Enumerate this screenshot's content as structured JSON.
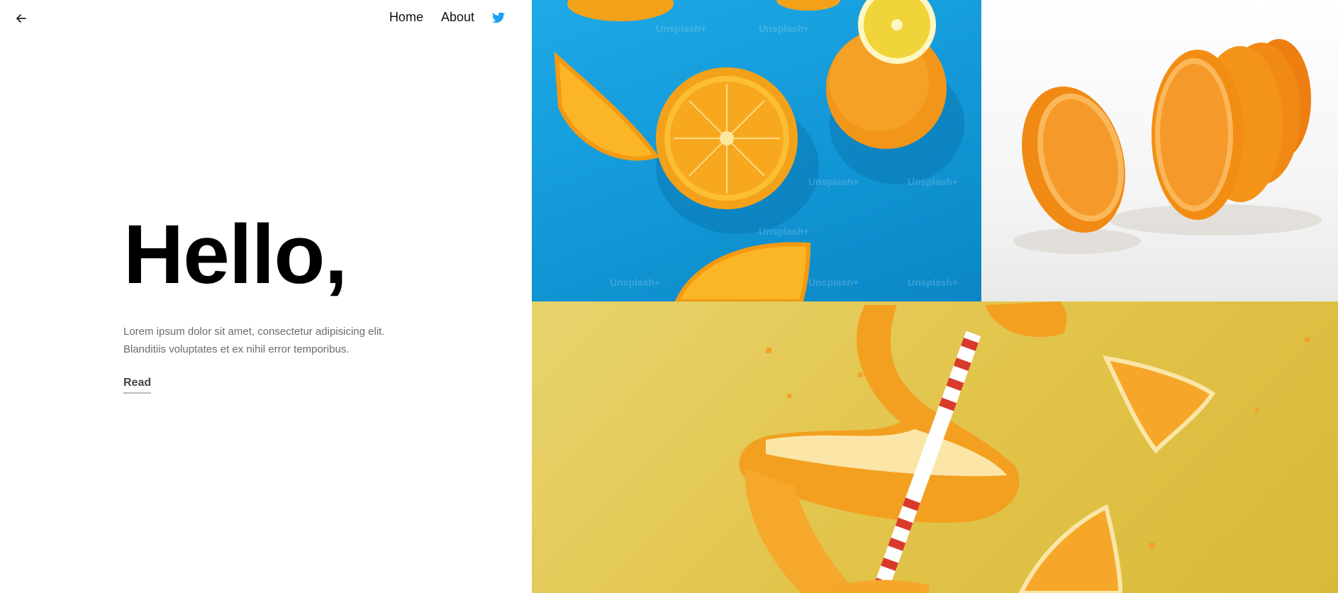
{
  "nav": {
    "back_icon": "arrow-left-icon",
    "home_label": "Home",
    "about_label": "About",
    "social_icon": "twitter-icon",
    "twitter_color": "#1da1f2"
  },
  "hero": {
    "title": "Hello,",
    "text_line1": "Lorem ipsum dolor sit amet, consectetur adipisicing elit.",
    "text_line2": "Blanditiis voluptates et ex nihil error temporibus.",
    "read_label": "Read"
  },
  "gallery": {
    "watermark": "Unsplash+",
    "images": [
      {
        "name": "orange-slices-on-blue"
      },
      {
        "name": "sliced-orange-on-white"
      },
      {
        "name": "orange-peel-with-straw-on-yellow"
      }
    ]
  }
}
